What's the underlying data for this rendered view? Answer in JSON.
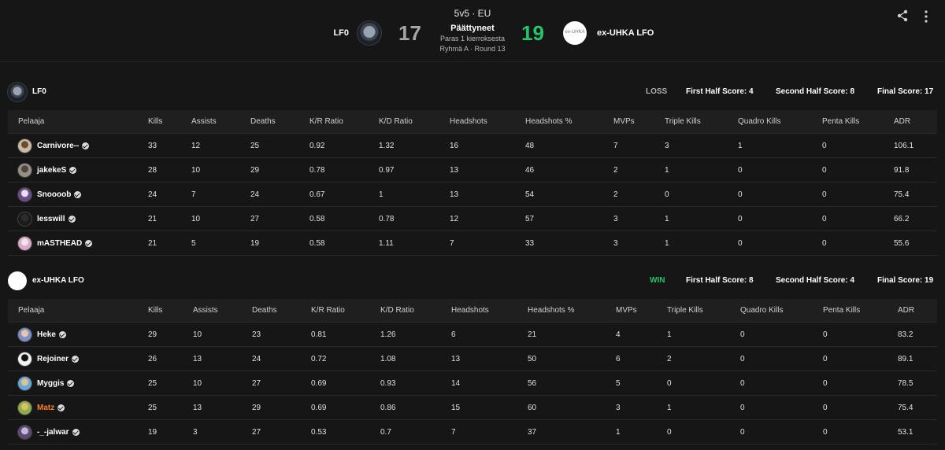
{
  "header": {
    "mode": "5v5 · EU",
    "team_a": "LF0",
    "team_b": "ex-UHKA LFO",
    "team_b_logo_text": "ex-UHKA",
    "score_a": "17",
    "score_b": "19",
    "status": "Päättyneet",
    "best_of": "Paras 1 kierroksesta",
    "round": "Ryhmä A · Round 13",
    "icons": [
      "share-icon",
      "more-vertical-icon"
    ]
  },
  "columns": [
    "Pelaaja",
    "Kills",
    "Assists",
    "Deaths",
    "K/R Ratio",
    "K/D Ratio",
    "Headshots",
    "Headshots %",
    "MVPs",
    "Triple Kills",
    "Quadro Kills",
    "Penta Kills",
    "ADR"
  ],
  "teams": [
    {
      "name": "LF0",
      "result": "LOSS",
      "first_half": "First Half Score: 4",
      "second_half": "Second Half Score: 8",
      "final": "Final Score: 17",
      "players": [
        {
          "name": "Carnivore--",
          "stats": [
            "33",
            "12",
            "25",
            "0.92",
            "1.32",
            "16",
            "48",
            "7",
            "3",
            "1",
            "0",
            "106.1"
          ]
        },
        {
          "name": "jakekeS",
          "stats": [
            "28",
            "10",
            "29",
            "0.78",
            "0.97",
            "13",
            "46",
            "2",
            "1",
            "0",
            "0",
            "91.8"
          ]
        },
        {
          "name": "Snoooob",
          "stats": [
            "24",
            "7",
            "24",
            "0.67",
            "1",
            "13",
            "54",
            "2",
            "0",
            "0",
            "0",
            "75.4"
          ]
        },
        {
          "name": "lesswill",
          "stats": [
            "21",
            "10",
            "27",
            "0.58",
            "0.78",
            "12",
            "57",
            "3",
            "1",
            "0",
            "0",
            "66.2"
          ]
        },
        {
          "name": "mASTHEAD",
          "stats": [
            "21",
            "5",
            "19",
            "0.58",
            "1.11",
            "7",
            "33",
            "3",
            "1",
            "0",
            "0",
            "55.6"
          ]
        }
      ]
    },
    {
      "name": "ex-UHKA LFO",
      "result": "WIN",
      "first_half": "First Half Score: 8",
      "second_half": "Second Half Score: 4",
      "final": "Final Score: 19",
      "players": [
        {
          "name": "Heke",
          "stats": [
            "29",
            "10",
            "23",
            "0.81",
            "1.26",
            "6",
            "21",
            "4",
            "1",
            "0",
            "0",
            "83.2"
          ]
        },
        {
          "name": "Rejoiner",
          "stats": [
            "26",
            "13",
            "24",
            "0.72",
            "1.08",
            "13",
            "50",
            "6",
            "2",
            "0",
            "0",
            "89.1"
          ]
        },
        {
          "name": "Myggis",
          "stats": [
            "25",
            "10",
            "27",
            "0.69",
            "0.93",
            "14",
            "56",
            "5",
            "0",
            "0",
            "0",
            "78.5"
          ]
        },
        {
          "name": "Matz",
          "stats": [
            "25",
            "13",
            "29",
            "0.69",
            "0.86",
            "15",
            "60",
            "3",
            "1",
            "0",
            "0",
            "75.4"
          ]
        },
        {
          "name": "-_-jalwar",
          "stats": [
            "19",
            "3",
            "27",
            "0.53",
            "0.7",
            "7",
            "37",
            "1",
            "0",
            "0",
            "0",
            "53.1"
          ]
        }
      ]
    }
  ],
  "colors": {
    "background": "#161616",
    "win": "#27c46b",
    "loss_score": "#a7a7a7",
    "highlight_player": "#ff7d2a"
  }
}
